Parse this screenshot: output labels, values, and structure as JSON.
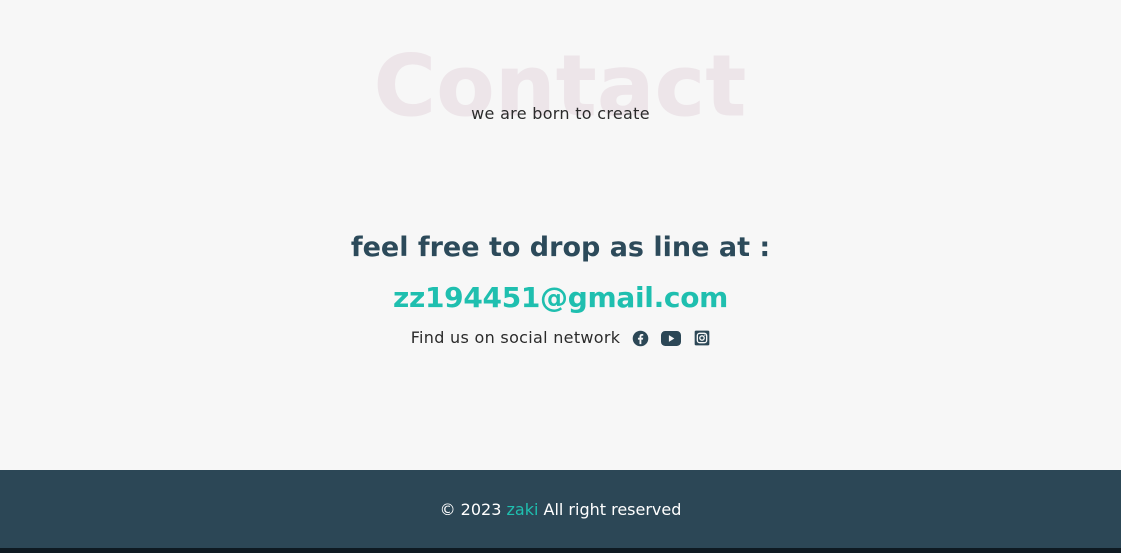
{
  "contact": {
    "bg_title": "Contact",
    "subtitle": "we are born to create",
    "heading": "feel free to drop as line at :",
    "email": "zz194451@gmail.com",
    "social_label": "Find us on social network",
    "social_icons": [
      "facebook-icon",
      "youtube-icon",
      "instagram-icon"
    ]
  },
  "footer": {
    "prefix": "© 2023",
    "brand": "zaki",
    "suffix": "All right reserved"
  },
  "colors": {
    "accent": "#1fbfaf",
    "heading": "#2c4a5a",
    "footer_bg": "#2c4756",
    "background": "#f7f7f7"
  }
}
